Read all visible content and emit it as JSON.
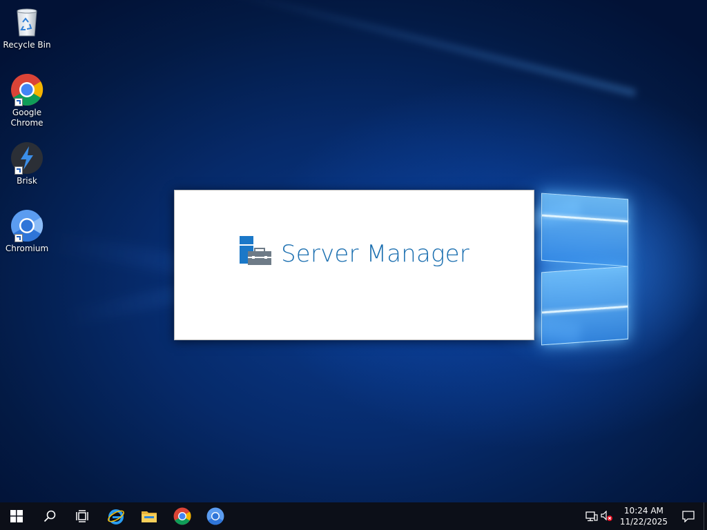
{
  "desktop": {
    "icons": [
      {
        "label": "Recycle Bin",
        "icon": "recycle-bin-icon"
      },
      {
        "label": "Google Chrome",
        "icon": "chrome-icon"
      },
      {
        "label": "Brisk",
        "icon": "brisk-icon"
      },
      {
        "label": "Chromium",
        "icon": "chromium-icon"
      }
    ]
  },
  "splash": {
    "title": "Server Manager",
    "icon": "server-manager-icon"
  },
  "taskbar": {
    "pinned": [
      {
        "icon": "windows-start-icon"
      },
      {
        "icon": "search-icon"
      },
      {
        "icon": "task-view-icon"
      },
      {
        "icon": "internet-explorer-icon"
      },
      {
        "icon": "file-explorer-icon"
      },
      {
        "icon": "chrome-icon"
      },
      {
        "icon": "chromium-icon"
      }
    ],
    "tray": {
      "time": "10:24 AM",
      "date": "11/22/2025",
      "network_icon": "network-icon",
      "volume_icon": "volume-muted-icon",
      "notification_icon": "action-center-icon"
    }
  },
  "colors": {
    "accent": "#1b6fb0",
    "taskbar": "#0c0f18",
    "wallpaper": "#062a6a"
  }
}
